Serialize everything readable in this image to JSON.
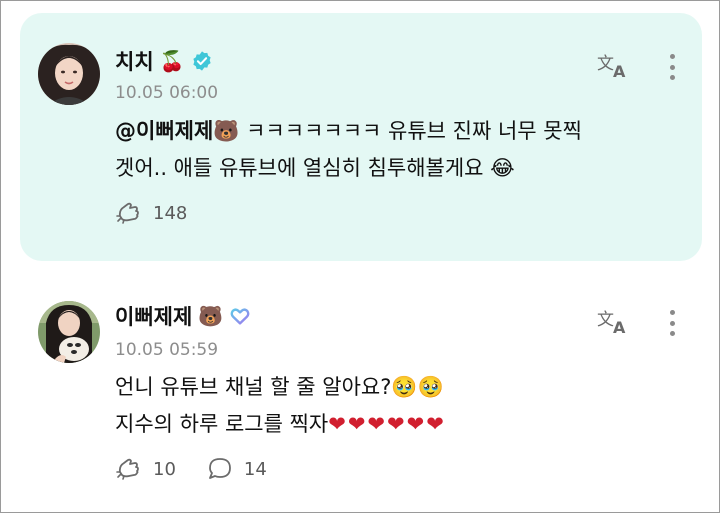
{
  "posts": [
    {
      "username": "치치",
      "name_emoji": "🍒",
      "badge": "verified-check",
      "timestamp": "10.05 06:00",
      "mention": "@이뻐제제🐻",
      "text_line1": " ㅋㅋㅋㅋㅋㅋㅋ 유튜브 진짜 너무 못찍",
      "text_line2": "겟어.. 애들 유튜브에 열심히 침투해볼게요 😂",
      "like_count": "148",
      "colors": {
        "background": "#e4f8f4",
        "badge": "#3fc7d8"
      }
    },
    {
      "username": "이뻐제제",
      "name_emoji": "🐻",
      "badge": "heart-outline",
      "timestamp": "10.05 05:59",
      "text_line1": "언니 유튜브 채널 할 줄 알아요?🥹🥹",
      "text_line2": "지수의 하루 로그를 찍자",
      "hearts": "❤❤❤❤❤❤",
      "like_count": "10",
      "comment_count": "14",
      "colors": {
        "badge": "#7a8cf0",
        "hearts": "#d11f2f"
      }
    }
  ]
}
